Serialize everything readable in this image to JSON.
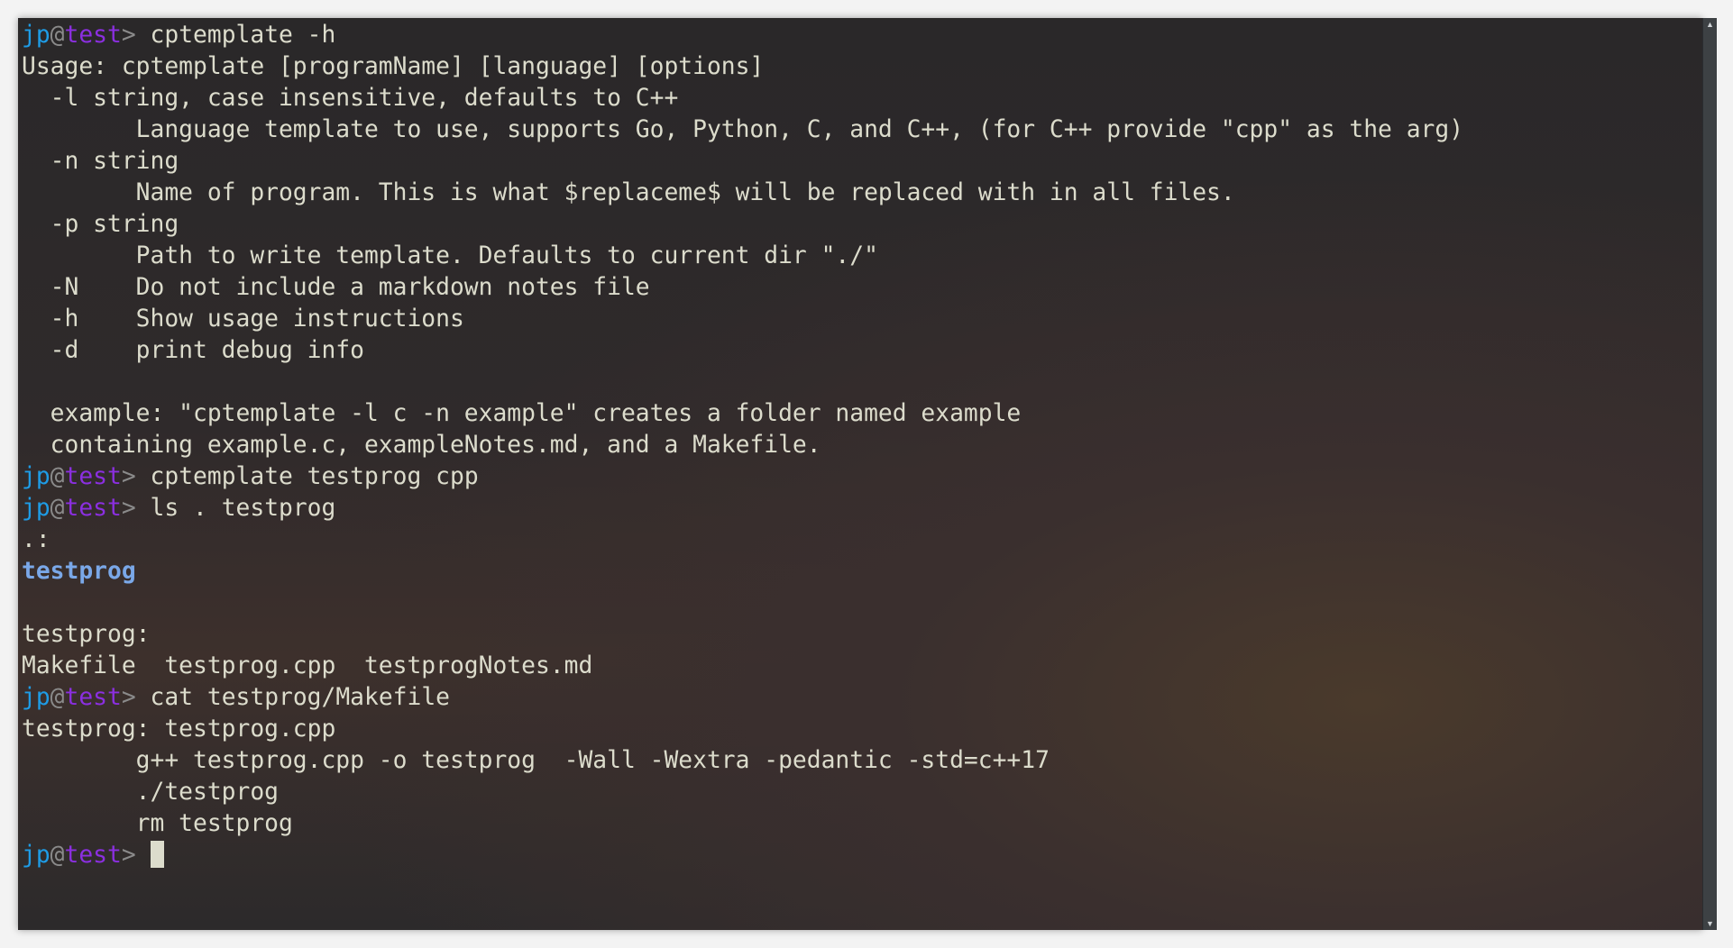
{
  "prompt": {
    "user": "jp",
    "at": "@",
    "host": "test",
    "symbol": "> "
  },
  "lines": [
    {
      "type": "prompt",
      "cmd": "cptemplate -h"
    },
    {
      "type": "text",
      "text": "Usage: cptemplate [programName] [language] [options]"
    },
    {
      "type": "text",
      "text": "  -l string, case insensitive, defaults to C++"
    },
    {
      "type": "text",
      "text": "        Language template to use, supports Go, Python, C, and C++, (for C++ provide \"cpp\" as the arg)"
    },
    {
      "type": "text",
      "text": "  -n string"
    },
    {
      "type": "text",
      "text": "        Name of program. This is what $replaceme$ will be replaced with in all files."
    },
    {
      "type": "text",
      "text": "  -p string"
    },
    {
      "type": "text",
      "text": "        Path to write template. Defaults to current dir \"./\""
    },
    {
      "type": "text",
      "text": "  -N    Do not include a markdown notes file"
    },
    {
      "type": "text",
      "text": "  -h    Show usage instructions"
    },
    {
      "type": "text",
      "text": "  -d    print debug info"
    },
    {
      "type": "text",
      "text": ""
    },
    {
      "type": "text",
      "text": "  example: \"cptemplate -l c -n example\" creates a folder named example"
    },
    {
      "type": "text",
      "text": "  containing example.c, exampleNotes.md, and a Makefile."
    },
    {
      "type": "prompt",
      "cmd": "cptemplate testprog cpp"
    },
    {
      "type": "prompt",
      "cmd": "ls . testprog"
    },
    {
      "type": "text",
      "text": ".:"
    },
    {
      "type": "dir",
      "text": "testprog"
    },
    {
      "type": "text",
      "text": ""
    },
    {
      "type": "text",
      "text": "testprog:"
    },
    {
      "type": "text",
      "text": "Makefile  testprog.cpp  testprogNotes.md"
    },
    {
      "type": "prompt",
      "cmd": "cat testprog/Makefile"
    },
    {
      "type": "text",
      "text": "testprog: testprog.cpp"
    },
    {
      "type": "text",
      "text": "        g++ testprog.cpp -o testprog  -Wall -Wextra -pedantic -std=c++17"
    },
    {
      "type": "text",
      "text": "        ./testprog"
    },
    {
      "type": "text",
      "text": "        rm testprog"
    },
    {
      "type": "prompt",
      "cmd": "",
      "cursor": true
    }
  ],
  "scrollbar": {
    "up_icon": "▲",
    "down_icon": "▼"
  }
}
